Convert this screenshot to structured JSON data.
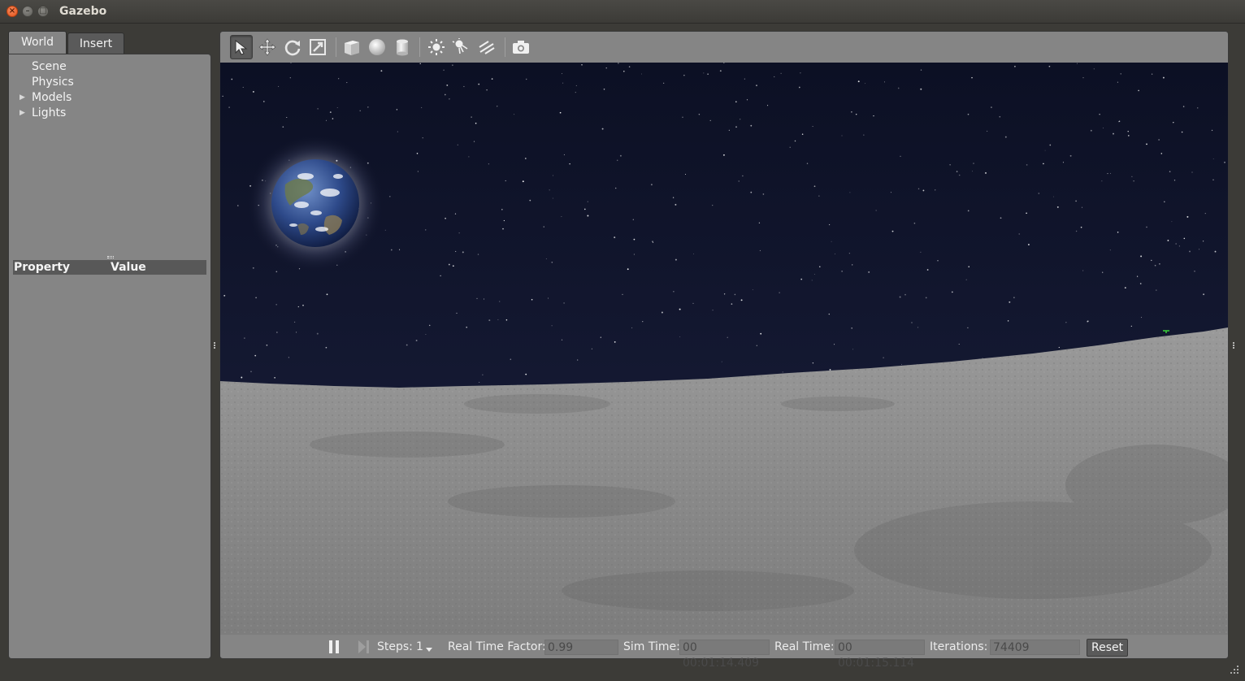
{
  "window": {
    "title": "Gazebo",
    "close_glyph": "×",
    "min_glyph": "–",
    "max_glyph": "□"
  },
  "left_panel": {
    "tabs": [
      {
        "label": "World",
        "active": true
      },
      {
        "label": "Insert",
        "active": false
      }
    ],
    "tree": [
      {
        "label": "Scene",
        "expandable": false
      },
      {
        "label": "Physics",
        "expandable": false
      },
      {
        "label": "Models",
        "expandable": true
      },
      {
        "label": "Lights",
        "expandable": true
      }
    ],
    "expand_glyph": "▶",
    "property_table": {
      "columns": [
        "Property",
        "Value"
      ]
    }
  },
  "toolbar": {
    "tools": [
      {
        "icon": "select-arrow-icon",
        "active": true
      },
      {
        "icon": "translate-icon",
        "active": false
      },
      {
        "icon": "rotate-icon",
        "active": false
      },
      {
        "icon": "scale-icon",
        "active": false
      },
      {
        "icon": "box-icon",
        "active": false
      },
      {
        "icon": "sphere-icon",
        "active": false
      },
      {
        "icon": "cylinder-icon",
        "active": false
      },
      {
        "icon": "point-light-icon",
        "active": false
      },
      {
        "icon": "spot-light-icon",
        "active": false
      },
      {
        "icon": "directional-light-icon",
        "active": false
      },
      {
        "icon": "screenshot-camera-icon",
        "active": false
      }
    ]
  },
  "status_bar": {
    "steps_label": "Steps:",
    "steps_value": "1",
    "rtf_label": "Real Time Factor:",
    "rtf_value": "0.99",
    "sim_time_label": "Sim Time:",
    "sim_time_value": "00 00:01:14.409",
    "real_time_label": "Real Time:",
    "real_time_value": "00 00:01:15.114",
    "iterations_label": "Iterations:",
    "iterations_value": "74409",
    "reset_label": "Reset"
  },
  "colors": {
    "panel_bg": "#858585",
    "window_bg": "#3c3b37",
    "sky": "#0f1328",
    "terrain": "#8a8a8a",
    "close_button": "#e2531b"
  }
}
